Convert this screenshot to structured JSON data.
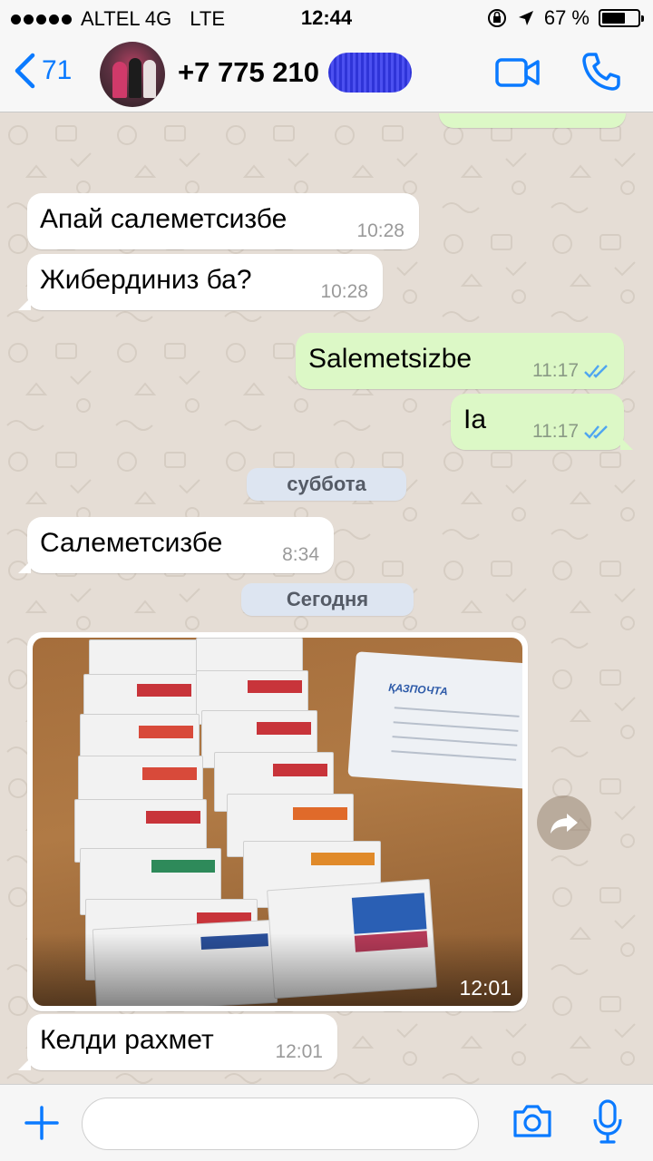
{
  "status_bar": {
    "carrier": "ALTEL 4G",
    "network": "LTE",
    "time": "12:44",
    "battery": "67 %",
    "battery_level": 0.67
  },
  "header": {
    "back_count": "71",
    "contact": "+7 775 210"
  },
  "messages": [
    {
      "direction": "in",
      "text": "Апай салеметсизбе",
      "time": "10:28"
    },
    {
      "direction": "in",
      "text": "Жибердиниз ба?",
      "time": "10:28"
    },
    {
      "direction": "out",
      "text": "Salemetsizbe",
      "time": "11:17",
      "status": "read"
    },
    {
      "direction": "out",
      "text": "Ia",
      "time": "11:17",
      "status": "read"
    },
    {
      "type": "date",
      "text": "суббота"
    },
    {
      "direction": "in",
      "text": "Салеметсизбе",
      "time": "8:34"
    },
    {
      "type": "date",
      "text": "Сегодня"
    },
    {
      "direction": "in",
      "type": "photo",
      "time": "12:01"
    },
    {
      "direction": "in",
      "text": "Келди рахмет",
      "time": "12:01"
    }
  ],
  "input": {
    "value": "",
    "placeholder": ""
  },
  "colors": {
    "accent": "#0a7aff",
    "incoming": "#ffffff",
    "outgoing": "#dcf8c6",
    "read_ticks": "#4fa5f0",
    "wallpaper": "#e5ddd5"
  },
  "icons": [
    "back-chevron-icon",
    "video-call-icon",
    "phone-call-icon",
    "forward-icon",
    "plus-icon",
    "camera-icon",
    "microphone-icon",
    "lock-rotation-icon",
    "location-arrow-icon",
    "battery-icon"
  ]
}
